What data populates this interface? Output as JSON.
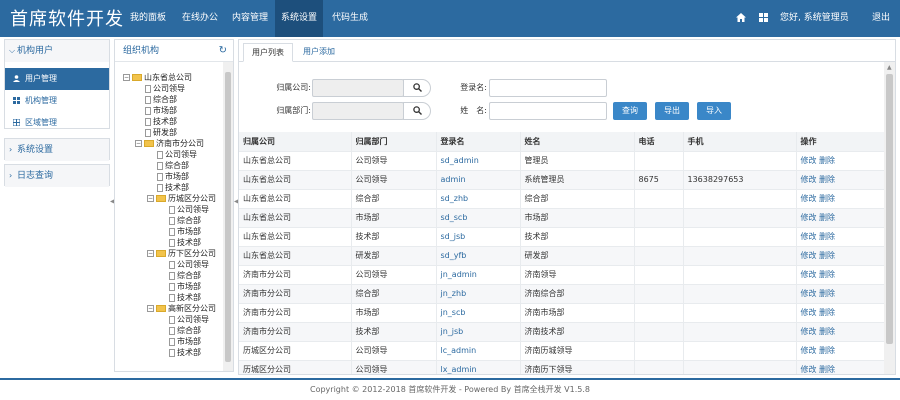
{
  "app": {
    "brand": "首席软件开发"
  },
  "nav": {
    "items": [
      "我的面板",
      "在线办公",
      "内容管理",
      "系统设置",
      "代码生成"
    ],
    "greeting": "您好, 系统管理员",
    "logout": "退出"
  },
  "sidebar": {
    "group1": "机构用户",
    "items": [
      "用户管理",
      "机构管理",
      "区域管理"
    ],
    "group2": "系统设置",
    "group3": "日志查询"
  },
  "tree": {
    "title": "组织机构",
    "nodes": [
      "山东省总公司",
      "公司领导",
      "综合部",
      "市场部",
      "技术部",
      "研发部",
      "济南市分公司",
      "公司领导",
      "综合部",
      "市场部",
      "技术部",
      "历城区分公司",
      "公司领导",
      "综合部",
      "市场部",
      "技术部",
      "历下区分公司",
      "公司领导",
      "综合部",
      "市场部",
      "技术部",
      "高新区分公司",
      "公司领导",
      "综合部",
      "市场部",
      "技术部"
    ]
  },
  "tabs": [
    "用户列表",
    "用户添加"
  ],
  "search": {
    "company_label": "归属公司:",
    "dept_label": "归属部门:",
    "login_label": "登录名:",
    "name_label": "姓　名:",
    "query": "查询",
    "export": "导出",
    "import": "导入"
  },
  "table": {
    "headers": [
      "归属公司",
      "归属部门",
      "登录名",
      "姓名",
      "电话",
      "手机",
      "操作"
    ],
    "edit": "修改",
    "delete": "删除",
    "rows": [
      [
        "山东省总公司",
        "公司领导",
        "sd_admin",
        "管理员",
        "",
        ""
      ],
      [
        "山东省总公司",
        "公司领导",
        "admin",
        "系统管理员",
        "8675",
        "13638297653"
      ],
      [
        "山东省总公司",
        "综合部",
        "sd_zhb",
        "综合部",
        "",
        ""
      ],
      [
        "山东省总公司",
        "市场部",
        "sd_scb",
        "市场部",
        "",
        ""
      ],
      [
        "山东省总公司",
        "技术部",
        "sd_jsb",
        "技术部",
        "",
        ""
      ],
      [
        "山东省总公司",
        "研发部",
        "sd_yfb",
        "研发部",
        "",
        ""
      ],
      [
        "济南市分公司",
        "公司领导",
        "jn_admin",
        "济南领导",
        "",
        ""
      ],
      [
        "济南市分公司",
        "综合部",
        "jn_zhb",
        "济南综合部",
        "",
        ""
      ],
      [
        "济南市分公司",
        "市场部",
        "jn_scb",
        "济南市场部",
        "",
        ""
      ],
      [
        "济南市分公司",
        "技术部",
        "jn_jsb",
        "济南技术部",
        "",
        ""
      ],
      [
        "历城区分公司",
        "公司领导",
        "lc_admin",
        "济南历城领导",
        "",
        ""
      ],
      [
        "历城区分公司",
        "公司领导",
        "lx_admin",
        "济南历下领导",
        "",
        ""
      ]
    ]
  },
  "footer": "Copyright © 2012-2018 首席软件开发 - Powered By 首席全栈开发 V1.5.8"
}
